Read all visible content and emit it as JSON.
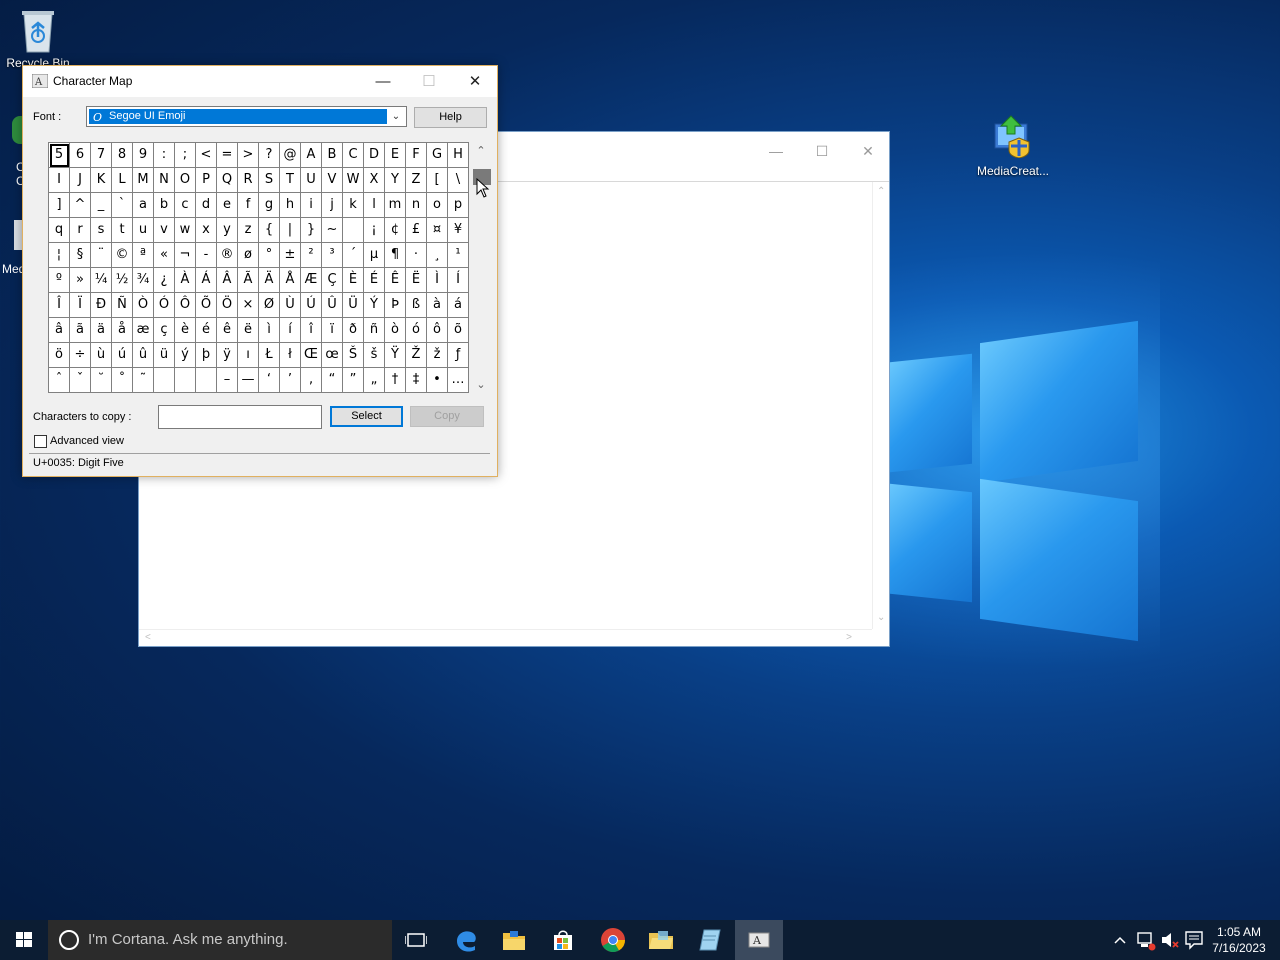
{
  "desktop": {
    "icons": [
      {
        "label": "Recycle Bin",
        "name": "recycle-bin"
      },
      {
        "label": "MediaCreat...",
        "name": "media-creation-tool"
      }
    ],
    "partial_icon_labels": [
      "C",
      "C",
      "Med"
    ]
  },
  "charmap": {
    "title": "Character Map",
    "font_label": "Font :",
    "font_value": "Segoe UI Emoji",
    "help_label": "Help",
    "chars_to_copy_label": "Characters to copy :",
    "chars_to_copy_value": "",
    "select_label": "Select",
    "copy_label": "Copy",
    "advanced_label": "Advanced view",
    "advanced_checked": false,
    "status": "U+0035: Digit Five",
    "grid_rows": [
      [
        "5",
        "6",
        "7",
        "8",
        "9",
        ":",
        ";",
        "<",
        "=",
        ">",
        "?",
        "@",
        "A",
        "B",
        "C",
        "D",
        "E",
        "F",
        "G",
        "H"
      ],
      [
        "I",
        "J",
        "K",
        "L",
        "M",
        "N",
        "O",
        "P",
        "Q",
        "R",
        "S",
        "T",
        "U",
        "V",
        "W",
        "X",
        "Y",
        "Z",
        "[",
        "\\"
      ],
      [
        "]",
        "^",
        "_",
        "`",
        "a",
        "b",
        "c",
        "d",
        "e",
        "f",
        "g",
        "h",
        "i",
        "j",
        "k",
        "l",
        "m",
        "n",
        "o",
        "p"
      ],
      [
        "q",
        "r",
        "s",
        "t",
        "u",
        "v",
        "w",
        "x",
        "y",
        "z",
        "{",
        "|",
        "}",
        "~",
        " ",
        "¡",
        "¢",
        "£",
        "¤",
        "¥"
      ],
      [
        "¦",
        "§",
        "¨",
        "©",
        "ª",
        "«",
        "¬",
        "-",
        "®",
        "ø",
        "°",
        "±",
        "²",
        "³",
        "´",
        "µ",
        "¶",
        "·",
        "¸",
        "¹"
      ],
      [
        "º",
        "»",
        "¼",
        "½",
        "¾",
        "¿",
        "À",
        "Á",
        "Â",
        "Ã",
        "Ä",
        "Å",
        "Æ",
        "Ç",
        "È",
        "É",
        "Ê",
        "Ë",
        "Ì",
        "Í"
      ],
      [
        "Î",
        "Ï",
        "Ð",
        "Ñ",
        "Ò",
        "Ó",
        "Ô",
        "Õ",
        "Ö",
        "×",
        "Ø",
        "Ù",
        "Ú",
        "Û",
        "Ü",
        "Ý",
        "Þ",
        "ß",
        "à",
        "á"
      ],
      [
        "â",
        "ã",
        "ä",
        "å",
        "æ",
        "ç",
        "è",
        "é",
        "ê",
        "ë",
        "ì",
        "í",
        "î",
        "ï",
        "ð",
        "ñ",
        "ò",
        "ó",
        "ô",
        "õ"
      ],
      [
        "ö",
        "÷",
        "ù",
        "ú",
        "û",
        "ü",
        "ý",
        "þ",
        "ÿ",
        "ı",
        "Ł",
        "ł",
        "Œ",
        "œ",
        "Š",
        "š",
        "Ÿ",
        "Ž",
        "ž",
        "ƒ"
      ],
      [
        "ˆ",
        "ˇ",
        "˘",
        "˚",
        "˜",
        " ",
        " ",
        " ",
        "–",
        "—",
        "‘",
        "’",
        "‚",
        "“",
        "”",
        "„",
        "†",
        "‡",
        "•",
        "…"
      ]
    ],
    "selected_char": "5"
  },
  "taskbar": {
    "search_placeholder": "I'm Cortana. Ask me anything.",
    "time": "1:05 AM",
    "date": "7/16/2023",
    "icons": [
      "task-view-icon",
      "edge-icon",
      "file-explorer-icon",
      "store-icon",
      "chrome-icon",
      "folder-icon",
      "notepad-icon",
      "charmap-icon"
    ]
  },
  "colors": {
    "accent": "#0078d7",
    "taskbar": "#0c1d33",
    "window_border": "#e0b060"
  }
}
